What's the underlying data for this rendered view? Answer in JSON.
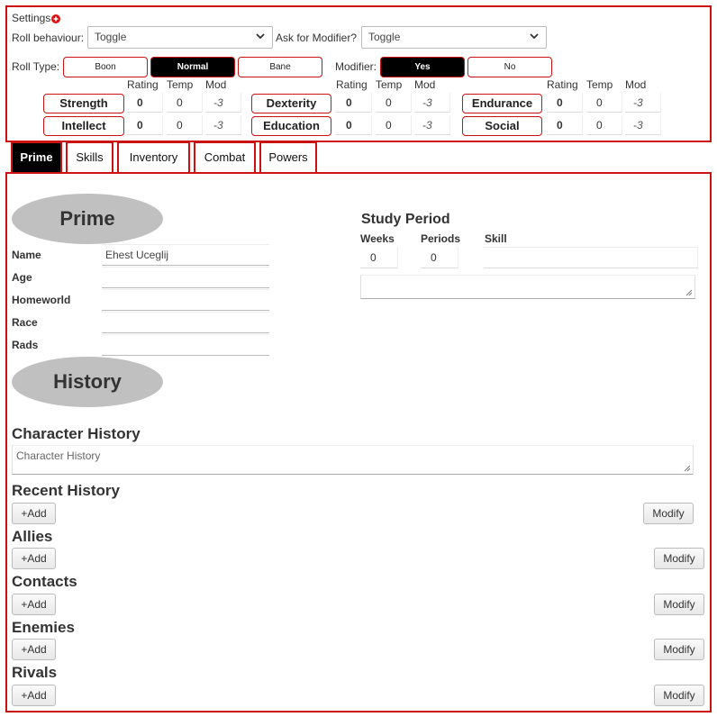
{
  "settings": {
    "title": "Settings",
    "roll_behaviour_label": "Roll behaviour:",
    "roll_behaviour_value": "Toggle",
    "ask_modifier_label": "Ask for Modifier?",
    "ask_modifier_value": "Toggle",
    "roll_type_label": "Roll Type:",
    "roll_types": [
      "Boon",
      "Normal",
      "Bane"
    ],
    "roll_type_selected": "Normal",
    "modifier_label": "Modifier:",
    "modifier_options": [
      "Yes",
      "No"
    ],
    "modifier_selected": "Yes"
  },
  "attributes": {
    "headers": [
      "Rating",
      "Temp",
      "Mod"
    ],
    "items": [
      {
        "name": "Strength",
        "rating": "0",
        "temp": "0",
        "mod": "-3"
      },
      {
        "name": "Dexterity",
        "rating": "0",
        "temp": "0",
        "mod": "-3"
      },
      {
        "name": "Endurance",
        "rating": "0",
        "temp": "0",
        "mod": "-3"
      },
      {
        "name": "Intellect",
        "rating": "0",
        "temp": "0",
        "mod": "-3"
      },
      {
        "name": "Education",
        "rating": "0",
        "temp": "0",
        "mod": "-3"
      },
      {
        "name": "Social",
        "rating": "0",
        "temp": "0",
        "mod": "-3"
      }
    ]
  },
  "tabs": [
    "Prime",
    "Skills",
    "Inventory",
    "Combat",
    "Powers"
  ],
  "active_tab": "Prime",
  "prime": {
    "title": "Prime",
    "fields": [
      {
        "label": "Name",
        "value": "Ehest Uceglij"
      },
      {
        "label": "Age",
        "value": ""
      },
      {
        "label": "Homeworld",
        "value": ""
      },
      {
        "label": "Race",
        "value": ""
      },
      {
        "label": "Rads",
        "value": ""
      }
    ]
  },
  "study": {
    "title": "Study Period",
    "weeks_label": "Weeks",
    "periods_label": "Periods",
    "skill_label": "Skill",
    "weeks_value": "0",
    "periods_value": "0",
    "skill_value": ""
  },
  "history": {
    "title": "History",
    "character_history_title": "Character History",
    "character_history_placeholder": "Character History",
    "sections": [
      "Recent History",
      "Allies",
      "Contacts",
      "Enemies",
      "Rivals"
    ],
    "add_label": "+Add",
    "modify_label": "Modify"
  },
  "colors": {
    "accent": "#cc1111",
    "active": "#000000",
    "oval": "#c0c0c0"
  },
  "icons": {
    "settings_toggle": "plus-circle-icon",
    "select": "chevron-down-icon"
  }
}
